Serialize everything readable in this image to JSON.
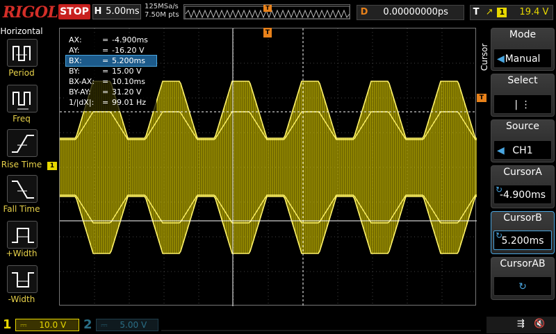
{
  "topbar": {
    "logo": "RIGOL",
    "run_state": "STOP",
    "timebase_key": "H",
    "timebase_value": "5.00ms",
    "sample_rate": "125MSa/s",
    "memory_depth": "7.50M pts",
    "delay_key": "D",
    "delay_value": "0.00000000ps",
    "trigger_key": "T",
    "trigger_source": "1",
    "trigger_level": "19.4 V",
    "trigger_marker": "T"
  },
  "left_menu": {
    "title": "Horizontal",
    "items": [
      {
        "label": "Period",
        "icon": "period-icon"
      },
      {
        "label": "Freq",
        "icon": "frequency-icon"
      },
      {
        "label": "Rise Time",
        "icon": "rise-time-icon"
      },
      {
        "label": "Fall Time",
        "icon": "fall-time-icon"
      },
      {
        "label": "+Width",
        "icon": "positive-width-icon"
      },
      {
        "label": "-Width",
        "icon": "negative-width-icon"
      }
    ]
  },
  "cursor_readout": {
    "rows": [
      {
        "name": "AX:",
        "value": "-4.900ms"
      },
      {
        "name": "AY:",
        "value": "-16.20 V"
      },
      {
        "name": "BX:",
        "value": "5.200ms"
      },
      {
        "name": "BY:",
        "value": "15.00 V"
      },
      {
        "name": "BX-AX:",
        "value": "10.10ms"
      },
      {
        "name": "BY-AY:",
        "value": "31.20 V"
      },
      {
        "name": "1/|dX|:",
        "value": "99.01 Hz"
      }
    ],
    "equals": "="
  },
  "right_menu": {
    "tab_label": "Cursor",
    "mode_label": "Mode",
    "mode_value": "Manual",
    "select_label": "Select",
    "select_value": "| ⋮",
    "source_label": "Source",
    "source_value": "CH1",
    "cursor_a_label": "CursorA",
    "cursor_a_value": "-4.900ms",
    "cursor_b_label": "CursorB",
    "cursor_b_value": "5.200ms",
    "cursor_ab_label": "CursorAB"
  },
  "bottombar": {
    "ch1_number": "1",
    "ch1_scale": "10.0 V",
    "ch2_number": "2",
    "ch2_scale": "5.00 V"
  },
  "colors": {
    "ch1": "#e8d800",
    "ch2": "#2a6e86",
    "accent": "#e8811a",
    "stop": "#c8201e"
  }
}
